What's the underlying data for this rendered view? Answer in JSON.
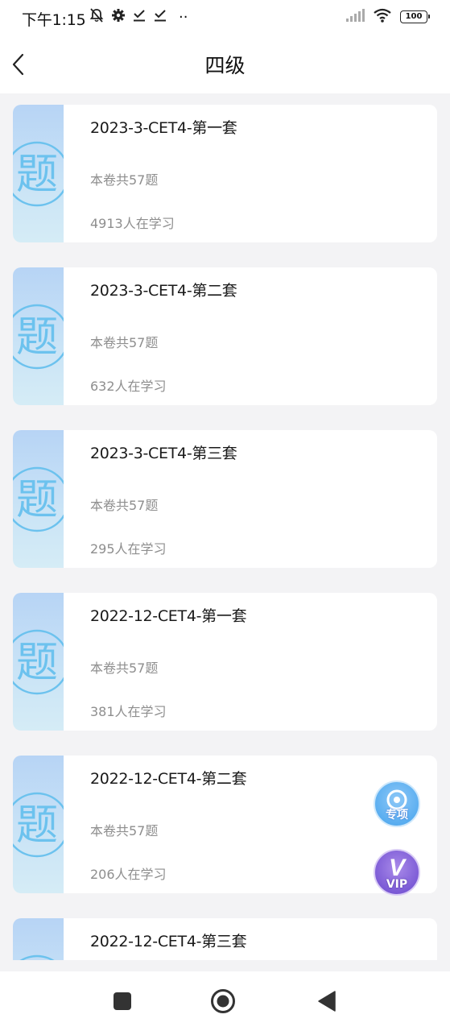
{
  "status_bar": {
    "time": "下午1:15",
    "more": "··",
    "battery": "100"
  },
  "header": {
    "title": "四级"
  },
  "thumb_glyph": "题",
  "papers": [
    {
      "title": "2023-3-CET4-第一套",
      "count": "本卷共57题",
      "learners": "4913人在学习"
    },
    {
      "title": "2023-3-CET4-第二套",
      "count": "本卷共57题",
      "learners": "632人在学习"
    },
    {
      "title": "2023-3-CET4-第三套",
      "count": "本卷共57题",
      "learners": "295人在学习"
    },
    {
      "title": "2022-12-CET4-第一套",
      "count": "本卷共57题",
      "learners": "381人在学习"
    },
    {
      "title": "2022-12-CET4-第二套",
      "count": "本卷共57题",
      "learners": "206人在学习"
    },
    {
      "title": "2022-12-CET4-第三套",
      "count": "",
      "learners": ""
    }
  ],
  "floating": {
    "topic_label": "专项",
    "vip_letter": "V",
    "vip_label": "VIP"
  },
  "colors": {
    "accent_blue": "#5aaef0",
    "vip_purple": "#7c5bd6",
    "thumb_stamp": "#6cc2ee"
  }
}
